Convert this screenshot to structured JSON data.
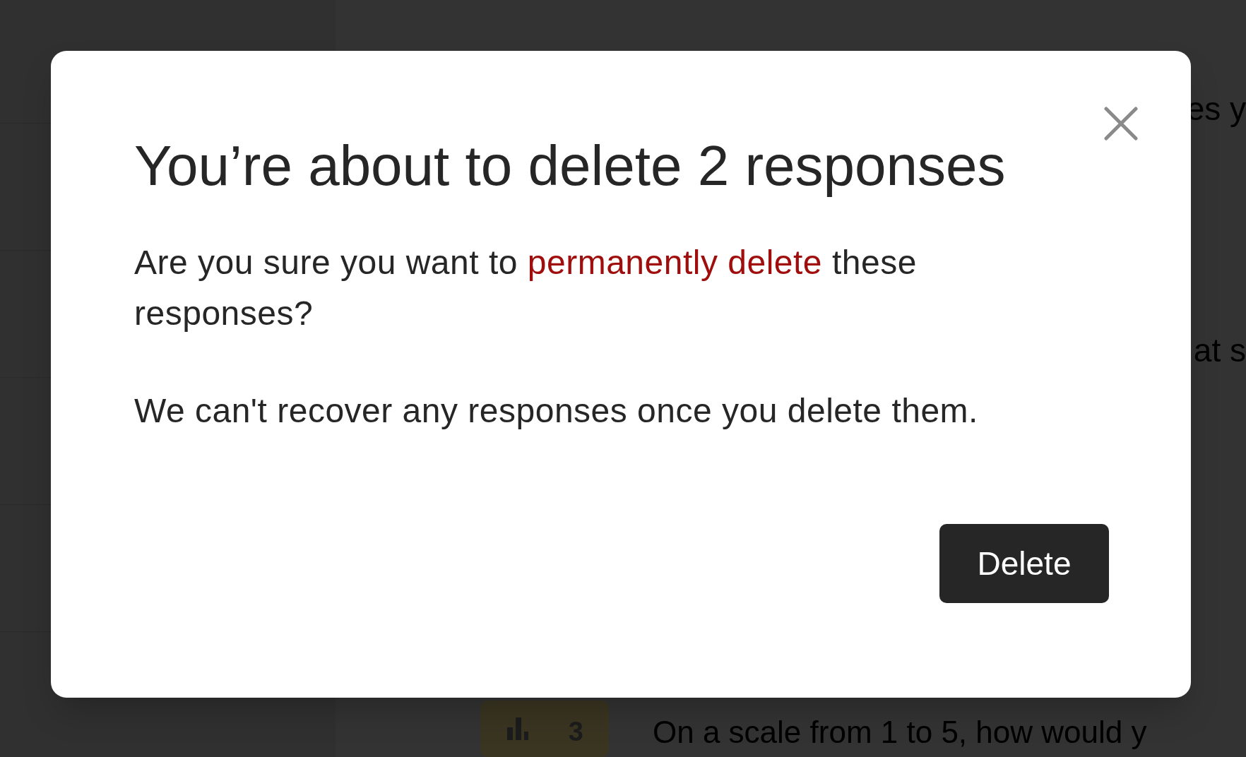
{
  "questions": [
    {
      "text": "es y"
    },
    {
      "text": "at s"
    }
  ],
  "bottom_question": {
    "number": "3",
    "text": "On a scale from 1 to 5, how would y"
  },
  "dialog": {
    "title": "You’re about to delete 2 responses",
    "message": {
      "before": "Are you sure you want to ",
      "emphasis": "permanently delete",
      "after": " these responses?"
    },
    "note": "We can't recover any responses once you delete them.",
    "button": "Delete"
  }
}
